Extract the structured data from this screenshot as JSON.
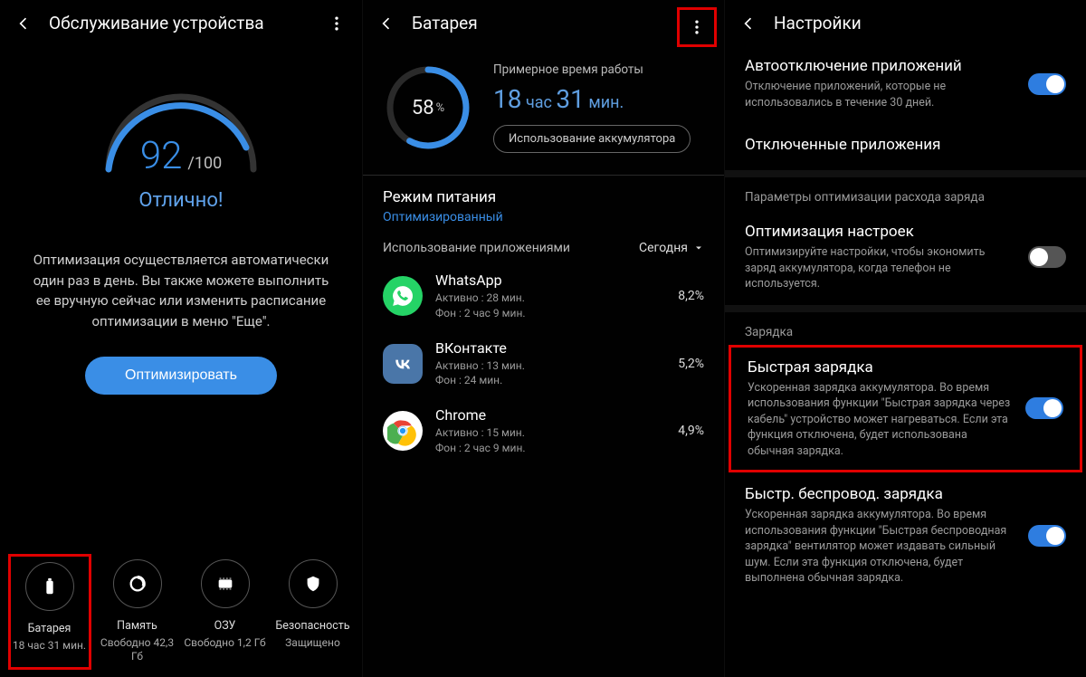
{
  "s1": {
    "title": "Обслуживание устройства",
    "score": "92",
    "scoreMax": "/100",
    "status": "Отлично!",
    "desc": "Оптимизация осуществляется автоматически один раз в день. Вы также можете выполнить ее вручную сейчас или изменить расписание оптимизации в меню \"Еще\".",
    "optimize": "Оптимизировать",
    "bottom": [
      {
        "label": "Батарея",
        "sub": "18 час 31 мин."
      },
      {
        "label": "Память",
        "sub": "Свободно 42,3 Гб"
      },
      {
        "label": "ОЗУ",
        "sub": "Свободно 1,2 Гб"
      },
      {
        "label": "Безопасность",
        "sub": "Защищено"
      }
    ]
  },
  "s2": {
    "title": "Батарея",
    "pct": "58",
    "pctUnit": "%",
    "estLabel": "Примерное время работы",
    "estH": "18",
    "estHu": " час ",
    "estM": "31",
    "estMu": " мин.",
    "usageBtn": "Использование аккумулятора",
    "modeTitle": "Режим питания",
    "modeSub": "Оптимизированный",
    "usageLbl": "Использование приложениями",
    "today": "Сегодня",
    "apps": [
      {
        "name": "WhatsApp",
        "sub1": "Активно : 28 мин.",
        "sub2": "Фон : 2 час 9 мин.",
        "pct": "8,2%"
      },
      {
        "name": "ВКонтакте",
        "sub1": "Активно : 13 мин.",
        "sub2": "Фон : 24 мин.",
        "pct": "5,2%"
      },
      {
        "name": "Chrome",
        "sub1": "Активно : 15 мин.",
        "sub2": "Фон : 2 час 9 мин.",
        "pct": "4,9%"
      }
    ]
  },
  "s3": {
    "title": "Настройки",
    "items": {
      "auto": {
        "title": "Автоотключение приложений",
        "sub": "Отключение приложений, которые не использовались в течение 30 дней."
      },
      "disabled": {
        "title": "Отключенные приложения"
      },
      "optHeader": "Параметры оптимизации расхода заряда",
      "opt": {
        "title": "Оптимизация настроек",
        "sub": "Оптимизируйте настройки, чтобы экономить заряд аккумулятора, когда телефон не используется."
      },
      "chargeHeader": "Зарядка",
      "fast": {
        "title": "Быстрая зарядка",
        "sub": "Ускоренная зарядка аккумулятора. Во время использования функции \"Быстрая зарядка через кабель\" устройство может нагреваться. Если эта функция отключена, будет использована обычная зарядка."
      },
      "wireless": {
        "title": "Быстр. беспровод. зарядка",
        "sub": "Ускоренная зарядка аккумулятора. Во время использования функции \"Быстрая беспроводная зарядка\" вентилятор может издавать сильный шум. Если эта функция отключена, будет выполнена обычная зарядка."
      }
    }
  }
}
